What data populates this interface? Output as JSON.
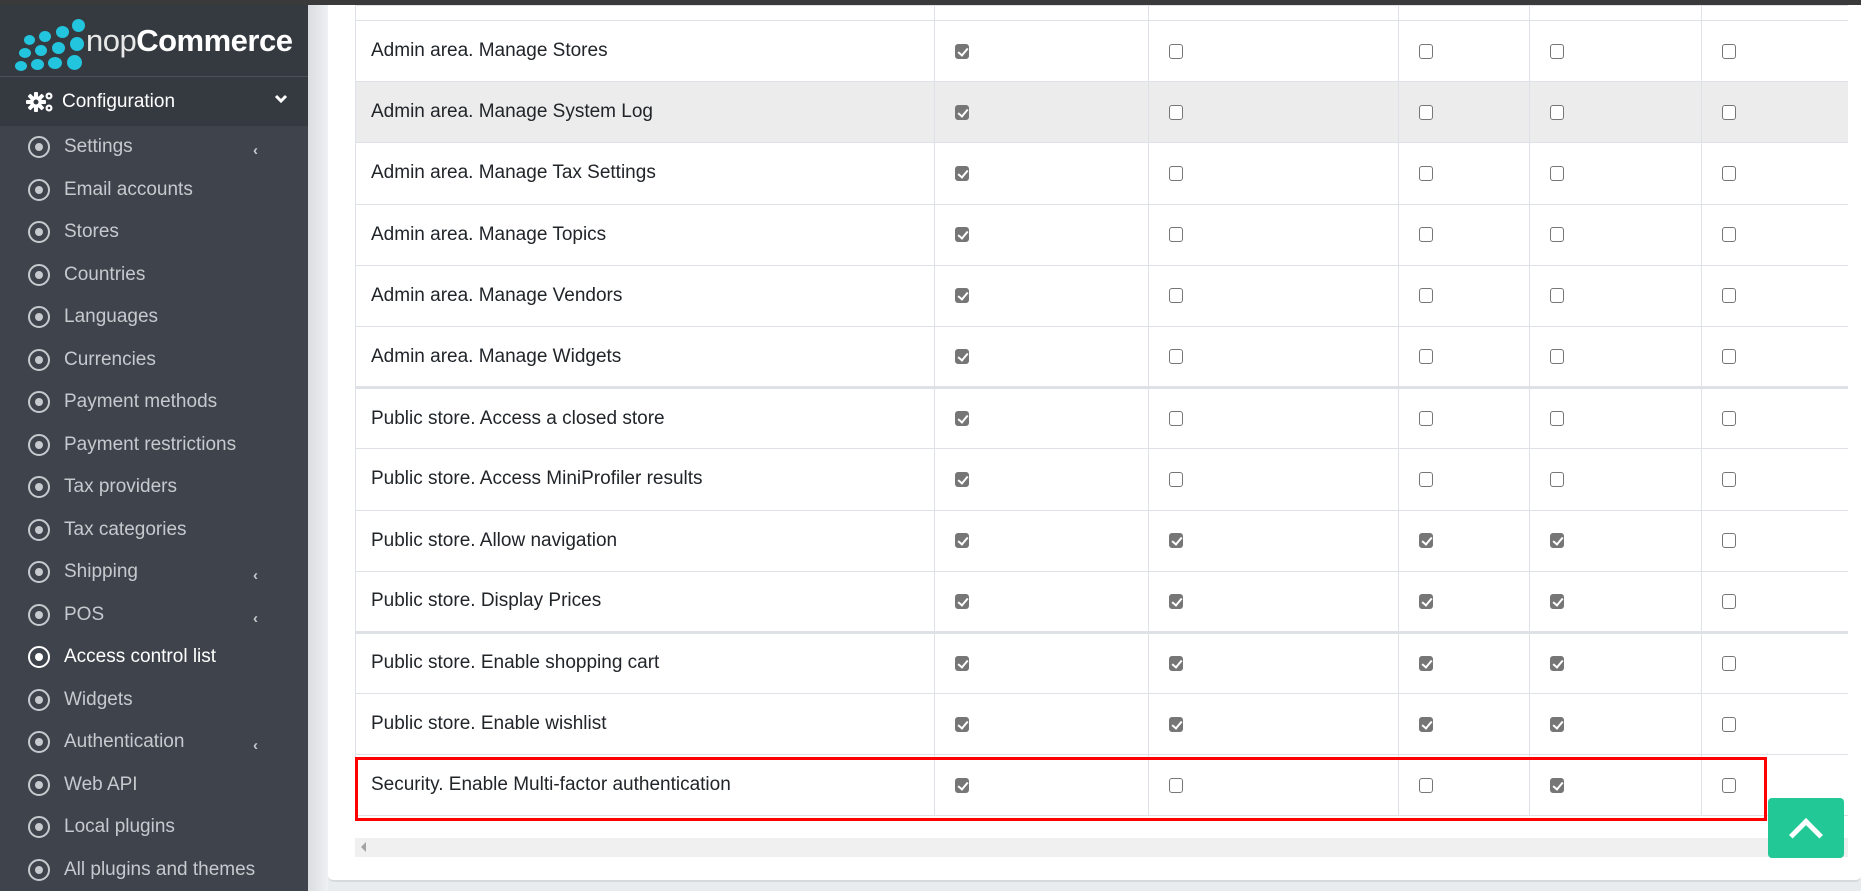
{
  "brand": {
    "name_light": "nop",
    "name_bold": "Commerce",
    "logo_color": "#23c4dd"
  },
  "sidebar": {
    "section_label": "Configuration",
    "items": [
      {
        "label": "Settings",
        "has_submenu": true,
        "active": false
      },
      {
        "label": "Email accounts",
        "has_submenu": false,
        "active": false
      },
      {
        "label": "Stores",
        "has_submenu": false,
        "active": false
      },
      {
        "label": "Countries",
        "has_submenu": false,
        "active": false
      },
      {
        "label": "Languages",
        "has_submenu": false,
        "active": false
      },
      {
        "label": "Currencies",
        "has_submenu": false,
        "active": false
      },
      {
        "label": "Payment methods",
        "has_submenu": false,
        "active": false
      },
      {
        "label": "Payment restrictions",
        "has_submenu": false,
        "active": false
      },
      {
        "label": "Tax providers",
        "has_submenu": false,
        "active": false
      },
      {
        "label": "Tax categories",
        "has_submenu": false,
        "active": false
      },
      {
        "label": "Shipping",
        "has_submenu": true,
        "active": false
      },
      {
        "label": "POS",
        "has_submenu": true,
        "active": false
      },
      {
        "label": "Access control list",
        "has_submenu": false,
        "active": true
      },
      {
        "label": "Widgets",
        "has_submenu": false,
        "active": false
      },
      {
        "label": "Authentication",
        "has_submenu": true,
        "active": false
      },
      {
        "label": "Web API",
        "has_submenu": false,
        "active": false
      },
      {
        "label": "Local plugins",
        "has_submenu": false,
        "active": false
      },
      {
        "label": "All plugins and themes",
        "has_submenu": false,
        "active": false
      }
    ]
  },
  "acl_table": {
    "rows": [
      {
        "name": "Admin area. Manage Stores",
        "perms": [
          true,
          false,
          false,
          false,
          false
        ]
      },
      {
        "name": "Admin area. Manage System Log",
        "perms": [
          true,
          false,
          false,
          false,
          false
        ],
        "hovered": true
      },
      {
        "name": "Admin area. Manage Tax Settings",
        "perms": [
          true,
          false,
          false,
          false,
          false
        ]
      },
      {
        "name": "Admin area. Manage Topics",
        "perms": [
          true,
          false,
          false,
          false,
          false
        ]
      },
      {
        "name": "Admin area. Manage Vendors",
        "perms": [
          true,
          false,
          false,
          false,
          false
        ]
      },
      {
        "name": "Admin area. Manage Widgets",
        "perms": [
          true,
          false,
          false,
          false,
          false
        ]
      },
      {
        "name": "Public store. Access a closed store",
        "perms": [
          true,
          false,
          false,
          false,
          false
        ],
        "group_start": true
      },
      {
        "name": "Public store. Access MiniProfiler results",
        "perms": [
          true,
          false,
          false,
          false,
          false
        ]
      },
      {
        "name": "Public store. Allow navigation",
        "perms": [
          true,
          true,
          true,
          true,
          false
        ]
      },
      {
        "name": "Public store. Display Prices",
        "perms": [
          true,
          true,
          true,
          true,
          false
        ]
      },
      {
        "name": "Public store. Enable shopping cart",
        "perms": [
          true,
          true,
          true,
          true,
          false
        ],
        "group_start": true
      },
      {
        "name": "Public store. Enable wishlist",
        "perms": [
          true,
          true,
          true,
          true,
          false
        ]
      },
      {
        "name": "Security. Enable Multi-factor authentication",
        "perms": [
          true,
          false,
          false,
          true,
          false
        ],
        "highlighted": true
      }
    ]
  },
  "highlight_color": "#ff0000",
  "scroll_top_button": {
    "icon": "chevron-up-icon",
    "color": "#22c997"
  }
}
